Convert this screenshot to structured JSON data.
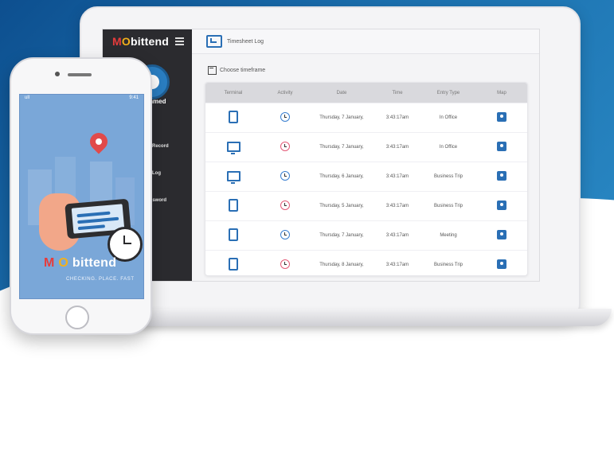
{
  "colors": {
    "brand_blue": "#2a6fb5",
    "sidebar_dark": "#2b2b2f",
    "accent_red": "#e14a4a",
    "accent_yellow": "#f2b01b",
    "phone_bg": "#7aa7d8"
  },
  "laptop": {
    "sidebar": {
      "brand": {
        "m": "M",
        "o": "O",
        "rest": "bittend"
      },
      "user_name": "e Ahmed",
      "items": [
        {
          "label": "heet Record",
          "icon": "clipboard-icon"
        },
        {
          "label": "heet Log",
          "icon": "list-icon"
        },
        {
          "label": "t Password",
          "icon": "key-icon"
        }
      ]
    },
    "header": {
      "title": "Timesheet Log",
      "icon": "timesheet-icon"
    },
    "choose": {
      "label": "Choose timeframe",
      "icon": "calendar-icon"
    },
    "table": {
      "columns": [
        "Terminal",
        "Activity",
        "Date",
        "Time",
        "Entry Type",
        "Map"
      ],
      "rows": [
        {
          "terminal": "mobile",
          "activity": "in",
          "date": "Thursday, 7 January,",
          "time": "3:43:17am",
          "entry_type": "In Office"
        },
        {
          "terminal": "desktop",
          "activity": "out",
          "date": "Thursday, 7 January,",
          "time": "3:43:17am",
          "entry_type": "In Office"
        },
        {
          "terminal": "desktop",
          "activity": "in",
          "date": "Thursday, 6 January,",
          "time": "3:43:17am",
          "entry_type": "Business Trip"
        },
        {
          "terminal": "mobile",
          "activity": "out",
          "date": "Thursday, 5 January,",
          "time": "3:43:17am",
          "entry_type": "Business Trip"
        },
        {
          "terminal": "mobile",
          "activity": "in",
          "date": "Thursday, 7 January,",
          "time": "3:43:17am",
          "entry_type": "Meeting"
        },
        {
          "terminal": "mobile",
          "activity": "out",
          "date": "Thursday, 8 January,",
          "time": "3:43:17am",
          "entry_type": "Business Trip"
        }
      ]
    }
  },
  "phone": {
    "status": {
      "left": "ull",
      "right": "9:41"
    },
    "logo": {
      "m": "M",
      "o": "O",
      "rest": "bittend"
    },
    "tagline": "CHECKING. PLACE. FAST"
  }
}
